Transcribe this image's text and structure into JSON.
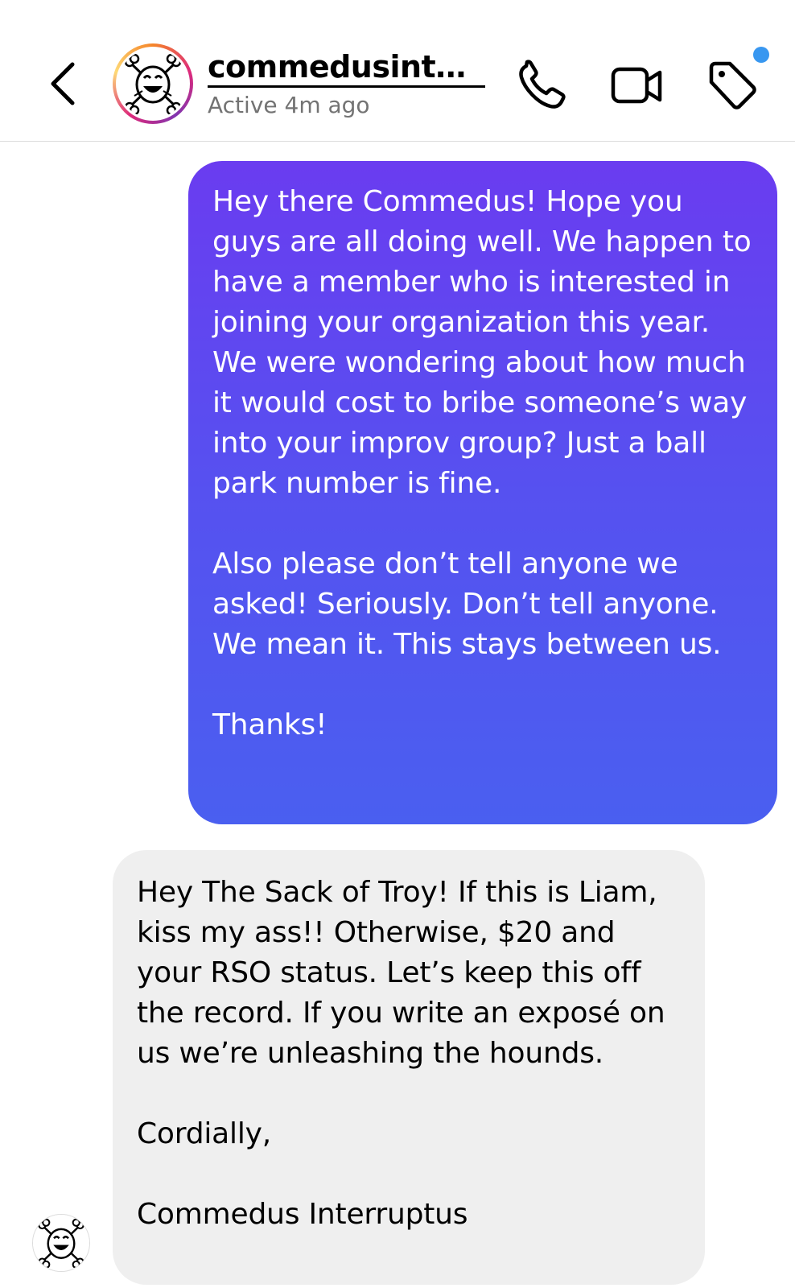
{
  "header": {
    "username": "commedusinter...",
    "status": "Active 4m ago",
    "icons": {
      "back": "chevron-left-icon",
      "phone": "phone-icon",
      "video": "video-camera-icon",
      "tag": "tag-icon",
      "notification_dot_color": "#3897f0"
    }
  },
  "messages": [
    {
      "direction": "sent",
      "paragraphs": [
        "Hey there Commedus! Hope you guys are all doing well. We happen to have a member who is interested in joining your organization this year. We were wondering about how much it would cost to bribe someone’s way into your improv group? Just a ball park number is fine.",
        "Also please don’t tell anyone we asked! Seriously. Don’t tell anyone. We mean it. This stays between us.",
        "Thanks!"
      ],
      "colors": {
        "gradient_top": "#6a3cf0",
        "gradient_bottom": "#4a5ff0",
        "text": "#ffffff"
      }
    },
    {
      "direction": "received",
      "paragraphs": [
        "Hey The Sack of Troy! If this is Liam, kiss my ass!! Otherwise, $20 and your RSO status. Let’s keep this off the record. If you write an exposé on us we’re unleashing the hounds.",
        "Cordially,",
        "Commedus Interruptus"
      ],
      "colors": {
        "background": "#efefef",
        "text": "#000000"
      }
    }
  ]
}
